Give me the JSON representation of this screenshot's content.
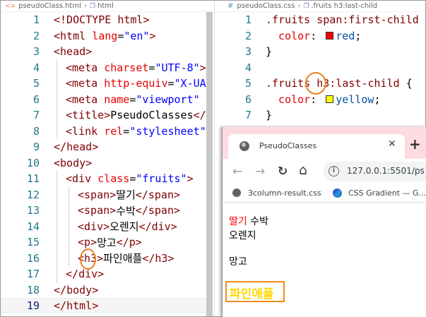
{
  "left_editor": {
    "breadcrumb": {
      "file": "pseudoClass.html",
      "node": "html"
    },
    "current_line": 19,
    "lines": [
      {
        "n": "1",
        "parts": [
          [
            "t-bracket",
            "<!DOCTYPE "
          ],
          [
            "t-tag",
            "html"
          ],
          [
            "t-bracket",
            ">"
          ]
        ]
      },
      {
        "n": "2",
        "parts": [
          [
            "t-bracket",
            "<"
          ],
          [
            "t-tag",
            "html "
          ],
          [
            "t-attr",
            "lang"
          ],
          [
            "t-txt",
            "="
          ],
          [
            "t-val",
            "\"en\""
          ],
          [
            "t-bracket",
            ">"
          ]
        ]
      },
      {
        "n": "3",
        "parts": [
          [
            "t-bracket",
            "<"
          ],
          [
            "t-tag",
            "head"
          ],
          [
            "t-bracket",
            ">"
          ]
        ]
      },
      {
        "n": "4",
        "parts": [
          [
            "t-bracket",
            "<"
          ],
          [
            "t-tag",
            "meta "
          ],
          [
            "t-attr",
            "charset"
          ],
          [
            "t-txt",
            "="
          ],
          [
            "t-val",
            "\"UTF-8\""
          ],
          [
            "t-bracket",
            ">"
          ]
        ]
      },
      {
        "n": "5",
        "parts": [
          [
            "t-bracket",
            "<"
          ],
          [
            "t-tag",
            "meta "
          ],
          [
            "t-attr",
            "http-equiv"
          ],
          [
            "t-txt",
            "="
          ],
          [
            "t-val",
            "\"X-UA-Com"
          ]
        ]
      },
      {
        "n": "6",
        "parts": [
          [
            "t-bracket",
            "<"
          ],
          [
            "t-tag",
            "meta "
          ],
          [
            "t-attr",
            "name"
          ],
          [
            "t-txt",
            "="
          ],
          [
            "t-val",
            "\"viewport\""
          ],
          [
            "t-txt",
            " "
          ],
          [
            "t-attr",
            "cont"
          ]
        ]
      },
      {
        "n": "7",
        "parts": [
          [
            "t-bracket",
            "<"
          ],
          [
            "t-tag",
            "title"
          ],
          [
            "t-bracket",
            ">"
          ],
          [
            "t-txt",
            "PseudoClasses"
          ],
          [
            "t-bracket",
            "</"
          ],
          [
            "t-tag",
            "titl"
          ]
        ]
      },
      {
        "n": "8",
        "parts": [
          [
            "t-bracket",
            "<"
          ],
          [
            "t-tag",
            "link "
          ],
          [
            "t-attr",
            "rel"
          ],
          [
            "t-txt",
            "="
          ],
          [
            "t-val",
            "\"stylesheet\""
          ],
          [
            "t-txt",
            " "
          ],
          [
            "t-attr",
            "hre"
          ]
        ]
      },
      {
        "n": "9",
        "parts": [
          [
            "t-bracket",
            "</"
          ],
          [
            "t-tag",
            "head"
          ],
          [
            "t-bracket",
            ">"
          ]
        ]
      },
      {
        "n": "10",
        "parts": [
          [
            "t-bracket",
            "<"
          ],
          [
            "t-tag",
            "body"
          ],
          [
            "t-bracket",
            ">"
          ]
        ]
      },
      {
        "n": "11",
        "parts": [
          [
            "t-bracket",
            "<"
          ],
          [
            "t-tag",
            "div "
          ],
          [
            "t-attr",
            "class"
          ],
          [
            "t-txt",
            "="
          ],
          [
            "t-val",
            "\"fruits\""
          ],
          [
            "t-bracket",
            ">"
          ]
        ]
      },
      {
        "n": "12",
        "parts": [
          [
            "t-bracket",
            "<"
          ],
          [
            "t-tag",
            "span"
          ],
          [
            "t-bracket",
            ">"
          ],
          [
            "t-txt",
            "딸기"
          ],
          [
            "t-bracket",
            "</"
          ],
          [
            "t-tag",
            "span"
          ],
          [
            "t-bracket",
            ">"
          ]
        ]
      },
      {
        "n": "13",
        "parts": [
          [
            "t-bracket",
            "<"
          ],
          [
            "t-tag",
            "span"
          ],
          [
            "t-bracket",
            ">"
          ],
          [
            "t-txt",
            "수박"
          ],
          [
            "t-bracket",
            "</"
          ],
          [
            "t-tag",
            "span"
          ],
          [
            "t-bracket",
            ">"
          ]
        ]
      },
      {
        "n": "14",
        "parts": [
          [
            "t-bracket",
            "<"
          ],
          [
            "t-tag",
            "div"
          ],
          [
            "t-bracket",
            ">"
          ],
          [
            "t-txt",
            "오렌지"
          ],
          [
            "t-bracket",
            "</"
          ],
          [
            "t-tag",
            "div"
          ],
          [
            "t-bracket",
            ">"
          ]
        ]
      },
      {
        "n": "15",
        "parts": [
          [
            "t-bracket",
            "<"
          ],
          [
            "t-tag",
            "p"
          ],
          [
            "t-bracket",
            ">"
          ],
          [
            "t-txt",
            "망고"
          ],
          [
            "t-bracket",
            "</"
          ],
          [
            "t-tag",
            "p"
          ],
          [
            "t-bracket",
            ">"
          ]
        ]
      },
      {
        "n": "16",
        "parts": [
          [
            "t-bracket",
            "<"
          ],
          [
            "t-tag",
            "h3"
          ],
          [
            "t-bracket",
            ">"
          ],
          [
            "t-txt",
            "파인애플"
          ],
          [
            "t-bracket",
            "</"
          ],
          [
            "t-tag",
            "h3"
          ],
          [
            "t-bracket",
            ">"
          ]
        ]
      },
      {
        "n": "17",
        "parts": [
          [
            "t-bracket",
            "</"
          ],
          [
            "t-tag",
            "div"
          ],
          [
            "t-bracket",
            ">"
          ]
        ]
      },
      {
        "n": "18",
        "parts": [
          [
            "t-bracket",
            "</"
          ],
          [
            "t-tag",
            "body"
          ],
          [
            "t-bracket",
            ">"
          ]
        ]
      },
      {
        "n": "19",
        "parts": [
          [
            "t-bracket",
            "</"
          ],
          [
            "t-tag",
            "html"
          ],
          [
            "t-bracket",
            ">"
          ]
        ]
      }
    ]
  },
  "right_editor": {
    "breadcrumb": {
      "file": "pseudoClass.css",
      "node": ".fruits h3:last-child"
    },
    "lines": [
      {
        "n": "1",
        "parts": [
          [
            "c-sel",
            ".fruits span:first-child "
          ],
          [
            "c-punc",
            "{"
          ]
        ]
      },
      {
        "n": "2",
        "parts": [
          [
            "c-prop",
            "  color"
          ],
          [
            "c-punc",
            ": "
          ],
          [
            "swatch",
            "#ff0000"
          ],
          [
            "c-val",
            "red"
          ],
          [
            "c-punc",
            ";"
          ]
        ]
      },
      {
        "n": "3",
        "parts": [
          [
            "c-punc",
            "}"
          ]
        ]
      },
      {
        "n": "4",
        "parts": []
      },
      {
        "n": "5",
        "parts": [
          [
            "c-sel",
            ".fruits h3:last-child "
          ],
          [
            "c-punc",
            "{"
          ]
        ]
      },
      {
        "n": "6",
        "parts": [
          [
            "c-prop",
            "  color"
          ],
          [
            "c-punc",
            ": "
          ],
          [
            "swatch",
            "#ffff00"
          ],
          [
            "c-val",
            "yellow"
          ],
          [
            "c-punc",
            ";"
          ]
        ]
      },
      {
        "n": "7",
        "parts": [
          [
            "c-punc",
            "}"
          ]
        ]
      }
    ]
  },
  "browser": {
    "tab_title": "PseudoClasses",
    "tab_close": "✕",
    "new_tab": "+",
    "back": "←",
    "forward": "→",
    "reload": "↻",
    "home": "⌂",
    "url": "127.0.0.1:5501/ps",
    "bookmarks": [
      {
        "label": "3column-result.css",
        "icon": "globe-icon"
      },
      {
        "label": "CSS Gradient — G...",
        "icon": "gradient-logo-icon"
      }
    ],
    "page": {
      "strawberry": "딸기",
      "watermelon": "수박",
      "orange": "오렌지",
      "mango": "망고",
      "pineapple": "파인애플"
    }
  },
  "colors": {
    "annotation": "#e8801f",
    "tab_strip": "#fcdce1",
    "red": "#ff0000",
    "yellow": "#ffd700"
  }
}
